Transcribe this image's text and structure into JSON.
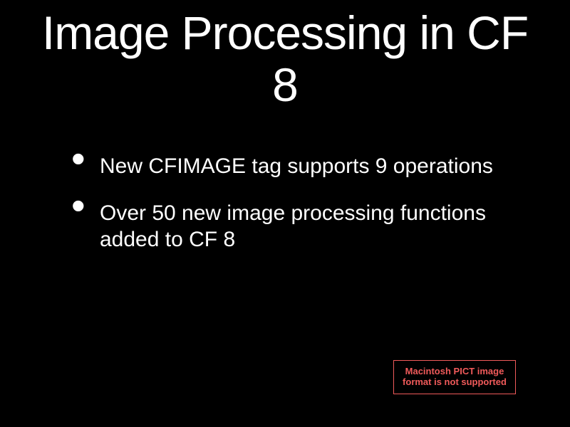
{
  "title": "Image Processing in CF 8",
  "bullets": [
    "New CFIMAGE tag supports 9 operations",
    "Over 50 new image processing functions added to CF 8"
  ],
  "pict_notice": "Macintosh PICT image format is not supported"
}
